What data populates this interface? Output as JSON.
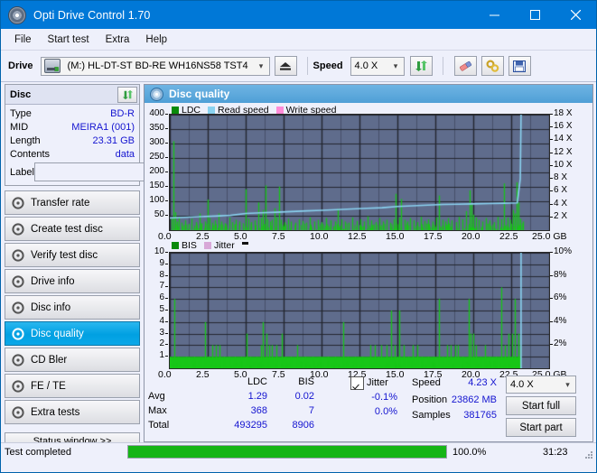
{
  "window": {
    "title": "Opti Drive Control 1.70",
    "icon": "disc-icon",
    "minimize": "minimize-icon",
    "maximize": "maximize-icon",
    "close": "close-icon"
  },
  "menu": {
    "items": [
      "File",
      "Start test",
      "Extra",
      "Help"
    ]
  },
  "toolbar": {
    "drive_label": "Drive",
    "drive_value": "(M:)  HL-DT-ST BD-RE  WH16NS58 TST4",
    "eject_icon": "eject-icon",
    "speed_label": "Speed",
    "speed_value": "4.0 X",
    "refresh_icon": "refresh-icon",
    "erase_icon": "eraser-icon",
    "tools_icon": "tools-icon",
    "save_icon": "save-icon"
  },
  "disc": {
    "header": "Disc",
    "refresh_icon": "refresh-icon",
    "rows": [
      {
        "key": "Type",
        "value": "BD-R"
      },
      {
        "key": "MID",
        "value": "MEIRA1 (001)"
      },
      {
        "key": "Length",
        "value": "23.31 GB"
      },
      {
        "key": "Contents",
        "value": "data"
      }
    ],
    "label_key": "Label",
    "label_value": "",
    "label_placeholder": "",
    "disc_icon": "cd-icon"
  },
  "nav": {
    "items": [
      {
        "label": "Transfer rate",
        "selected": false
      },
      {
        "label": "Create test disc",
        "selected": false
      },
      {
        "label": "Verify test disc",
        "selected": false
      },
      {
        "label": "Drive info",
        "selected": false
      },
      {
        "label": "Disc info",
        "selected": false
      },
      {
        "label": "Disc quality",
        "selected": true
      },
      {
        "label": "CD Bler",
        "selected": false
      },
      {
        "label": "FE / TE",
        "selected": false
      },
      {
        "label": "Extra tests",
        "selected": false
      }
    ],
    "status_window": "Status window >>"
  },
  "panel": {
    "title": "Disc quality",
    "icon": "disc-quality-icon"
  },
  "stats": {
    "col_ldc": "LDC",
    "col_bis": "BIS",
    "rows": [
      {
        "label": "Avg",
        "ldc": "1.29",
        "bis": "0.02"
      },
      {
        "label": "Max",
        "ldc": "368",
        "bis": "7"
      },
      {
        "label": "Total",
        "ldc": "493295",
        "bis": "8906"
      }
    ],
    "jitter_label": "Jitter",
    "jitter_checked": true,
    "jitter_values": [
      "-0.1%",
      "0.0%"
    ],
    "speed_label": "Speed",
    "speed_value": "4.23 X",
    "position_label": "Position",
    "position_value": "23862 MB",
    "samples_label": "Samples",
    "samples_value": "381765",
    "speed_select": "4.0 X",
    "start_full": "Start full",
    "start_part": "Start part"
  },
  "statusbar": {
    "text": "Test completed",
    "percent": "100.0%",
    "time": "31:23",
    "progress": 100
  },
  "colors": {
    "accent": "#0078d7",
    "plot_bg": "#5f6c8c",
    "ldc_green": "#18c618",
    "read_speed": "#8ad2f0",
    "write_speed": "#ff8cd8",
    "jitter": "#d8a8d8",
    "value_blue": "#1414d0",
    "progress_green": "#16b516"
  },
  "chart_data": [
    {
      "type": "line",
      "name": "ldc-chart",
      "title": "",
      "xlabel": "GB",
      "ylabel": "",
      "legend": [
        {
          "label": "LDC",
          "color": "#0a8a0a"
        },
        {
          "label": "Read speed",
          "color": "#8ad2f0"
        },
        {
          "label": "Write speed",
          "color": "#ff8cd8"
        }
      ],
      "legend_position": "top-left",
      "grid": true,
      "xlim": [
        0,
        25
      ],
      "xticks": [
        "0.0",
        "2.5",
        "5.0",
        "7.5",
        "10.0",
        "12.5",
        "15.0",
        "17.5",
        "20.0",
        "22.5",
        "25.0 GB"
      ],
      "ylim": [
        0,
        400
      ],
      "yticks": [
        "50",
        "100",
        "150",
        "200",
        "250",
        "300",
        "350",
        "400"
      ],
      "y2lim": [
        0,
        18
      ],
      "y2ticks": [
        "2 X",
        "4 X",
        "6 X",
        "8 X",
        "10 X",
        "12 X",
        "14 X",
        "16 X",
        "18 X"
      ],
      "series": [
        {
          "name": "LDC",
          "color": "#18c618",
          "render": "spikes",
          "points": [
            [
              0.1,
              40
            ],
            [
              0.25,
              308
            ],
            [
              0.33,
              62
            ],
            [
              0.45,
              30
            ],
            [
              0.6,
              46
            ],
            [
              0.8,
              26
            ],
            [
              1.0,
              34
            ],
            [
              1.25,
              22
            ],
            [
              1.45,
              40
            ],
            [
              1.7,
              28
            ],
            [
              1.95,
              58
            ],
            [
              2.1,
              24
            ],
            [
              2.35,
              30
            ],
            [
              2.48,
              106
            ],
            [
              2.62,
              42
            ],
            [
              2.8,
              26
            ],
            [
              3.0,
              34
            ],
            [
              3.2,
              58
            ],
            [
              3.4,
              30
            ],
            [
              3.65,
              24
            ],
            [
              3.9,
              44
            ],
            [
              4.1,
              28
            ],
            [
              4.35,
              36
            ],
            [
              4.6,
              30
            ],
            [
              4.85,
              24
            ],
            [
              5.0,
              142
            ],
            [
              5.15,
              40
            ],
            [
              5.35,
              28
            ],
            [
              5.6,
              34
            ],
            [
              5.85,
              96
            ],
            [
              6.0,
              42
            ],
            [
              6.15,
              70
            ],
            [
              6.28,
              155
            ],
            [
              6.45,
              38
            ],
            [
              6.6,
              30
            ],
            [
              6.75,
              36
            ],
            [
              6.9,
              76
            ],
            [
              7.05,
              44
            ],
            [
              7.2,
              151
            ],
            [
              7.35,
              36
            ],
            [
              7.55,
              28
            ],
            [
              7.8,
              40
            ],
            [
              8.0,
              30
            ],
            [
              8.25,
              26
            ],
            [
              8.5,
              38
            ],
            [
              8.75,
              32
            ],
            [
              9.0,
              26
            ],
            [
              9.25,
              44
            ],
            [
              9.5,
              30
            ],
            [
              9.75,
              36
            ],
            [
              10.0,
              28
            ],
            [
              10.3,
              42
            ],
            [
              10.6,
              34
            ],
            [
              10.9,
              30
            ],
            [
              11.1,
              74
            ],
            [
              11.3,
              38
            ],
            [
              11.55,
              30
            ],
            [
              11.8,
              26
            ],
            [
              12.05,
              44
            ],
            [
              12.3,
              32
            ],
            [
              12.55,
              38
            ],
            [
              12.8,
              30
            ],
            [
              13.05,
              48
            ],
            [
              13.3,
              34
            ],
            [
              13.55,
              28
            ],
            [
              13.8,
              42
            ],
            [
              14.05,
              30
            ],
            [
              14.3,
              36
            ],
            [
              14.55,
              26
            ],
            [
              14.75,
              38
            ],
            [
              14.9,
              126
            ],
            [
              15.1,
              44
            ],
            [
              15.25,
              108
            ],
            [
              15.45,
              36
            ],
            [
              15.65,
              30
            ],
            [
              15.85,
              42
            ],
            [
              16.05,
              34
            ],
            [
              16.3,
              28
            ],
            [
              16.55,
              46
            ],
            [
              16.8,
              32
            ],
            [
              17.05,
              38
            ],
            [
              17.3,
              30
            ],
            [
              17.55,
              44
            ],
            [
              17.75,
              120
            ],
            [
              17.95,
              36
            ],
            [
              18.15,
              30
            ],
            [
              18.35,
              42
            ],
            [
              18.6,
              34
            ],
            [
              18.85,
              28
            ],
            [
              19.05,
              46
            ],
            [
              19.3,
              38
            ],
            [
              19.55,
              66
            ],
            [
              19.75,
              138
            ],
            [
              19.88,
              90
            ],
            [
              20.0,
              54
            ],
            [
              20.15,
              44
            ],
            [
              20.35,
              36
            ],
            [
              20.6,
              30
            ],
            [
              20.85,
              42
            ],
            [
              21.1,
              34
            ],
            [
              21.35,
              28
            ],
            [
              21.6,
              46
            ],
            [
              21.85,
              38
            ],
            [
              22.05,
              162
            ],
            [
              22.25,
              44
            ],
            [
              22.45,
              36
            ],
            [
              22.6,
              70
            ],
            [
              22.75,
              58
            ],
            [
              22.88,
              166
            ],
            [
              23.0,
              96
            ],
            [
              23.12,
              40
            ],
            [
              23.25,
              30
            ]
          ]
        },
        {
          "name": "Read speed",
          "color": "#8ad2f0",
          "render": "line",
          "points": [
            [
              0.0,
              1.9
            ],
            [
              1.0,
              2.0
            ],
            [
              2.0,
              2.1
            ],
            [
              3.0,
              2.2
            ],
            [
              4.0,
              2.3
            ],
            [
              5.0,
              2.6
            ],
            [
              6.0,
              2.7
            ],
            [
              7.0,
              2.8
            ],
            [
              8.0,
              2.9
            ],
            [
              9.0,
              3.0
            ],
            [
              10.0,
              3.1
            ],
            [
              11.0,
              3.2
            ],
            [
              12.0,
              3.3
            ],
            [
              13.0,
              3.4
            ],
            [
              14.0,
              3.5
            ],
            [
              15.0,
              3.7
            ],
            [
              16.0,
              3.8
            ],
            [
              17.0,
              3.9
            ],
            [
              18.0,
              4.0
            ],
            [
              19.0,
              4.05
            ],
            [
              20.0,
              4.1
            ],
            [
              21.0,
              4.15
            ],
            [
              22.0,
              4.2
            ],
            [
              22.9,
              4.25
            ],
            [
              23.1,
              8.0
            ],
            [
              23.15,
              18.0
            ]
          ]
        }
      ]
    },
    {
      "type": "line",
      "name": "bis-chart",
      "title": "",
      "xlabel": "GB",
      "ylabel": "",
      "legend": [
        {
          "label": "BIS",
          "color": "#0a8a0a"
        },
        {
          "label": "Jitter",
          "color": "#d8a8d8"
        }
      ],
      "legend_position": "top-left",
      "grid": true,
      "xlim": [
        0,
        25
      ],
      "xticks": [
        "0.0",
        "2.5",
        "5.0",
        "7.5",
        "10.0",
        "12.5",
        "15.0",
        "17.5",
        "20.0",
        "22.5",
        "25.0 GB"
      ],
      "ylim": [
        0,
        10
      ],
      "yticks": [
        "1",
        "2",
        "3",
        "4",
        "5",
        "6",
        "7",
        "8",
        "9",
        "10"
      ],
      "y2lim": [
        0,
        10
      ],
      "y2ticks": [
        "2%",
        "4%",
        "6%",
        "8%",
        "10%"
      ],
      "series": [
        {
          "name": "BIS",
          "color": "#18c618",
          "render": "spikes",
          "baseline": 1,
          "points": [
            [
              0.3,
              6
            ],
            [
              0.55,
              1
            ],
            [
              1.05,
              1
            ],
            [
              1.6,
              1
            ],
            [
              2.0,
              1
            ],
            [
              2.3,
              4
            ],
            [
              2.55,
              1
            ],
            [
              2.8,
              2
            ],
            [
              3.05,
              2
            ],
            [
              3.3,
              2
            ],
            [
              3.55,
              1
            ],
            [
              3.9,
              1
            ],
            [
              4.3,
              1
            ],
            [
              4.7,
              1
            ],
            [
              5.05,
              3
            ],
            [
              5.3,
              1
            ],
            [
              5.7,
              1
            ],
            [
              6.0,
              2
            ],
            [
              6.15,
              4
            ],
            [
              6.35,
              3
            ],
            [
              6.55,
              2
            ],
            [
              6.75,
              2
            ],
            [
              7.05,
              2
            ],
            [
              7.4,
              3
            ],
            [
              7.6,
              1
            ],
            [
              8.0,
              1
            ],
            [
              8.4,
              2
            ],
            [
              8.9,
              1
            ],
            [
              9.4,
              1
            ],
            [
              9.9,
              1
            ],
            [
              10.4,
              1
            ],
            [
              10.9,
              1
            ],
            [
              11.4,
              4
            ],
            [
              11.7,
              1
            ],
            [
              12.2,
              1
            ],
            [
              12.7,
              1
            ],
            [
              13.2,
              2
            ],
            [
              13.5,
              2
            ],
            [
              13.75,
              1
            ],
            [
              13.95,
              2
            ],
            [
              14.3,
              2
            ],
            [
              14.6,
              5
            ],
            [
              14.85,
              2
            ],
            [
              15.1,
              5
            ],
            [
              15.4,
              2
            ],
            [
              15.7,
              1
            ],
            [
              16.0,
              2
            ],
            [
              16.3,
              2
            ],
            [
              16.6,
              1
            ],
            [
              17.0,
              1
            ],
            [
              17.4,
              1
            ],
            [
              17.75,
              6
            ],
            [
              18.0,
              1
            ],
            [
              18.25,
              2
            ],
            [
              18.5,
              2
            ],
            [
              18.8,
              2
            ],
            [
              19.0,
              2
            ],
            [
              19.3,
              1
            ],
            [
              19.7,
              6
            ],
            [
              19.85,
              3
            ],
            [
              20.0,
              3
            ],
            [
              20.2,
              2
            ],
            [
              20.5,
              1
            ],
            [
              20.8,
              2
            ],
            [
              21.1,
              1
            ],
            [
              21.5,
              1
            ],
            [
              21.85,
              7
            ],
            [
              22.1,
              2
            ],
            [
              22.35,
              3
            ],
            [
              22.55,
              3
            ],
            [
              22.75,
              6
            ],
            [
              22.95,
              3
            ],
            [
              23.1,
              2
            ]
          ]
        },
        {
          "name": "Jitter",
          "color": "#8ad2f0",
          "render": "line",
          "points": [
            [
              23.15,
              0
            ],
            [
              23.15,
              10
            ]
          ]
        }
      ]
    }
  ]
}
